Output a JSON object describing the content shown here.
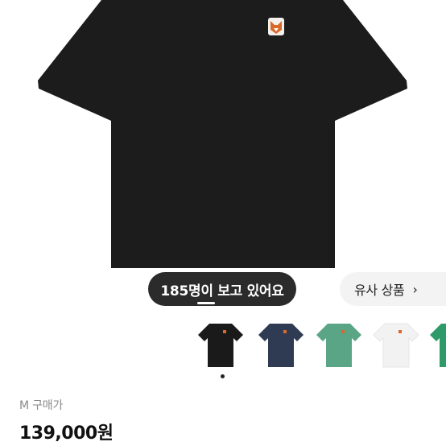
{
  "viewers_badge": {
    "text": "185명이 보고 있어요"
  },
  "similar_products": {
    "label": "유사 상품",
    "chevron": "›"
  },
  "thumbnails": [
    {
      "color": "#1a1a1a"
    },
    {
      "color": "#2f3b52"
    },
    {
      "color": "#5aa585"
    },
    {
      "color": "#f2f2f2"
    },
    {
      "color": "#2e9a6a"
    }
  ],
  "product": {
    "main_color": "#1c1c1c",
    "size_label": "M 구매가",
    "price": "139,000원"
  },
  "carousel": {
    "active_index": 0
  }
}
